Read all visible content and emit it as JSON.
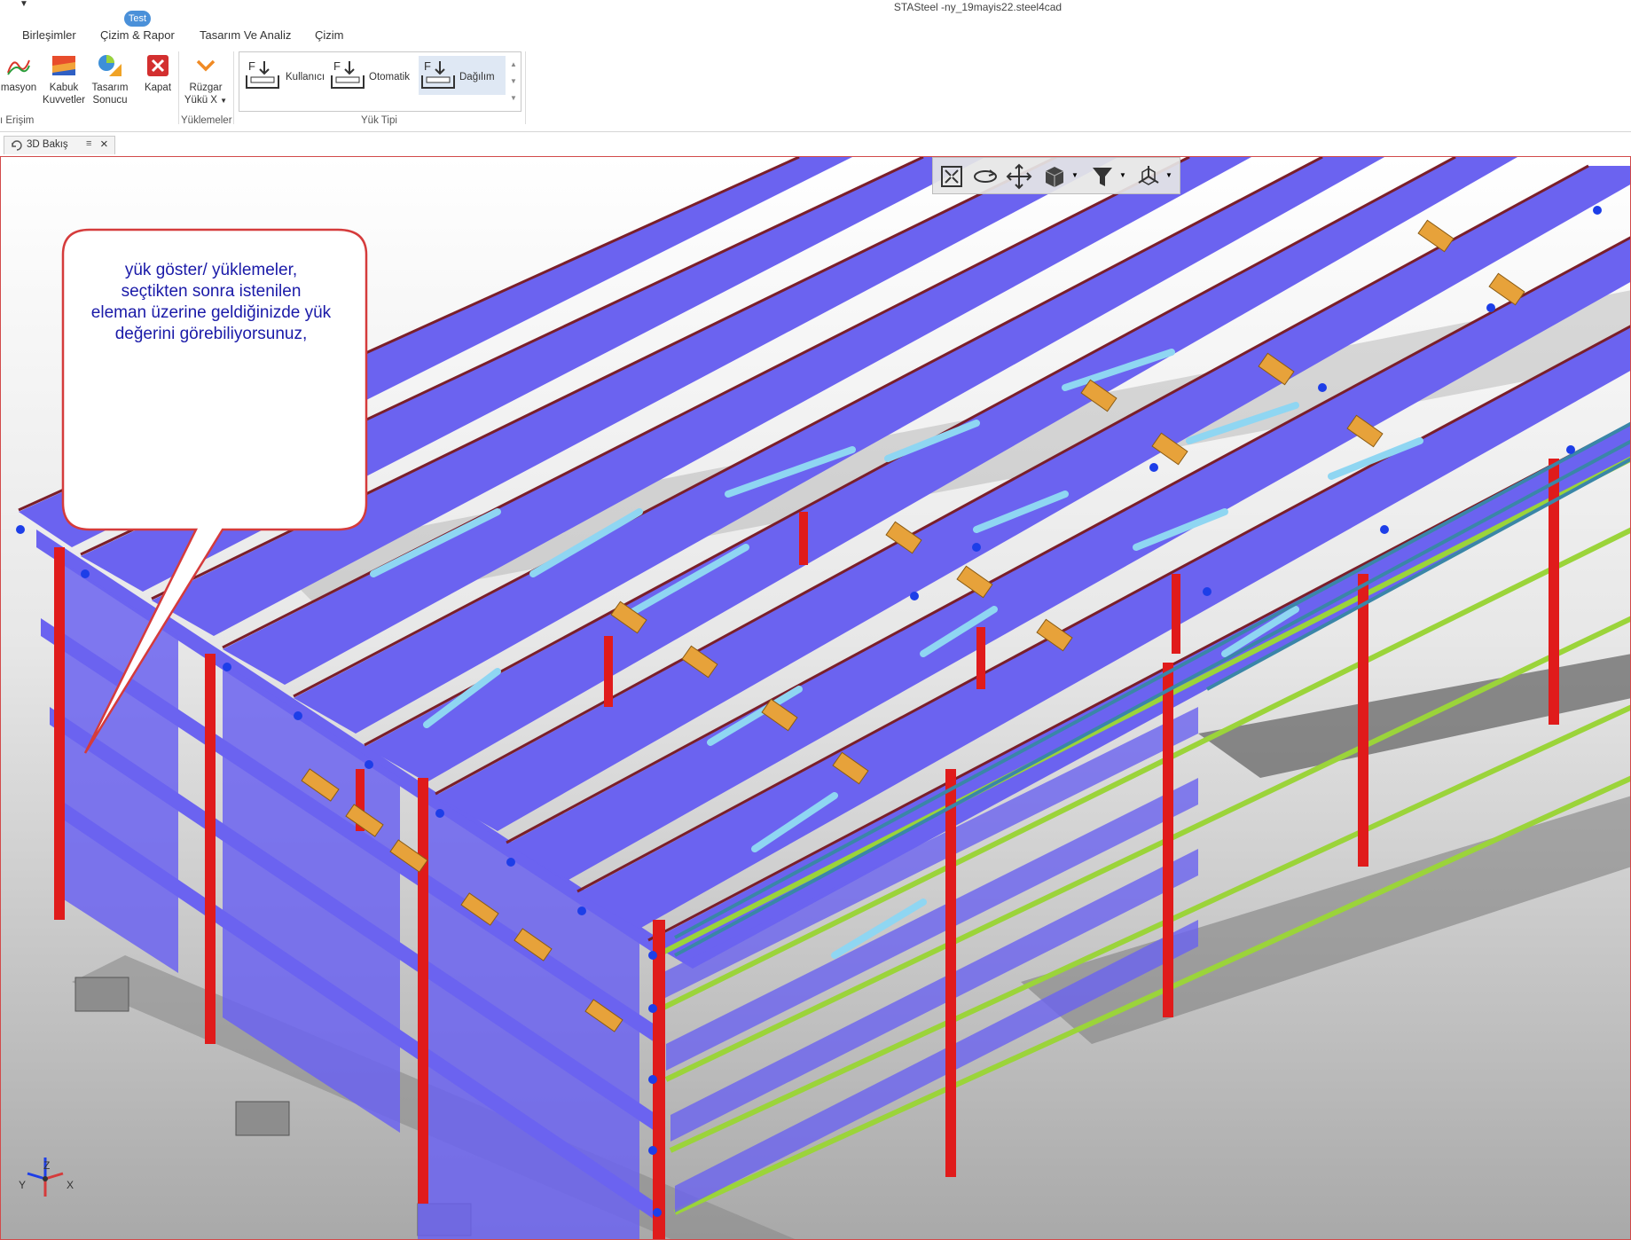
{
  "window": {
    "title": "STASteel -ny_19mayis22.steel4cad",
    "quick_access_icon": "dropdown-arrow-icon"
  },
  "menu": {
    "items": [
      "Birleşimler",
      "Çizim & Rapor",
      "Tasarım Ve Analiz",
      "Çizim"
    ],
    "badge": "Test"
  },
  "ribbon": {
    "buttons": {
      "animasyon": "masyon",
      "kabuk_1": "Kabuk",
      "kabuk_2": "Kuvvetler",
      "tasarim_1": "Tasarım",
      "tasarim_2": "Sonucu",
      "kapat": "Kapat",
      "ruzgar_1": "Rüzgar",
      "ruzgar_2": "Yükü X"
    },
    "load_types": [
      "Kullanıcı",
      "Otomatik",
      "Dağılım"
    ],
    "groups": {
      "hizli_erisim": "ı Erişim",
      "yuklemeler": "Yüklemeler",
      "yuk_tipi": "Yük Tipi"
    }
  },
  "tabs": {
    "active": "3D Bakış",
    "pin_icon": "pin-icon",
    "close_icon": "close-icon"
  },
  "viewport": {
    "toolbar_icons": [
      "zoom-extents-icon",
      "rotate-icon",
      "pan-icon",
      "view-cube-icon",
      "filter-icon",
      "axis-view-icon"
    ],
    "callout": {
      "line1": "yük göster/ yüklemeler,",
      "line2": "seçtikten sonra istenilen",
      "line3": "eleman üzerine geldiğinizde yük",
      "line4": "değerini görebiliyorsunuz,"
    },
    "axes": {
      "z": "Z",
      "y": "Y",
      "x": "X"
    }
  },
  "colors": {
    "purlin": "#6b63f0",
    "column": "#e01b1b",
    "girt": "#9bd43a",
    "brace": "#8fd6f2",
    "haunch": "#e7a23a",
    "load_arrow": "#1d3ee8",
    "callout_border": "#d53b3b",
    "callout_text": "#1a1aa8",
    "viewport_border": "#d24a4a"
  }
}
